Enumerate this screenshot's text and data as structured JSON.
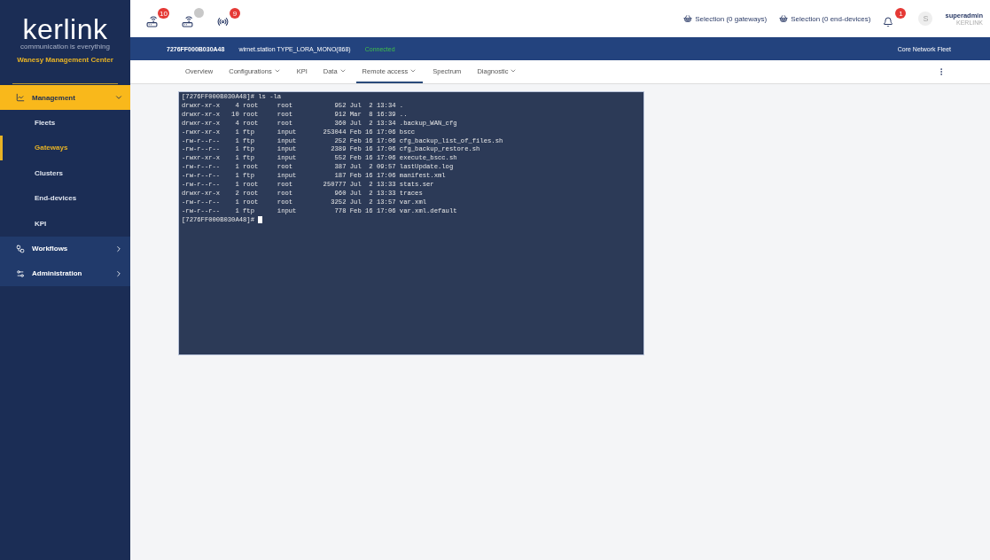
{
  "brand": {
    "logo": "kerlink",
    "tagline": "communication is everything",
    "product": "Wanesy Management Center"
  },
  "header_icons": [
    {
      "kind": "gateway",
      "badge": "10"
    },
    {
      "kind": "gateway-offline"
    },
    {
      "kind": "antenna",
      "badge": "9"
    }
  ],
  "selections": [
    "Selection (0 gateways)",
    "Selection (0 end-devices)"
  ],
  "notifications": {
    "badge": "1"
  },
  "user": {
    "initial": "S",
    "name": "superadmin",
    "org": "KERLINK"
  },
  "device_bar": {
    "id": "7276FF000B030A48",
    "type": "wirnet.station TYPE_LORA_MONO(868)",
    "status": "Connected",
    "fleet": "Core Network Fleet"
  },
  "tabs": [
    {
      "label": "Overview",
      "dropdown": false,
      "selected": false
    },
    {
      "label": "Configurations",
      "dropdown": true,
      "selected": false
    },
    {
      "label": "KPI",
      "dropdown": false,
      "selected": false
    },
    {
      "label": "Data",
      "dropdown": true,
      "selected": false
    },
    {
      "label": "Remote access",
      "dropdown": true,
      "selected": true
    },
    {
      "label": "Spectrum",
      "dropdown": false,
      "selected": false
    },
    {
      "label": "Diagnostic",
      "dropdown": true,
      "selected": false
    }
  ],
  "sidebar": [
    {
      "label": "Management",
      "expanded": true,
      "children": [
        {
          "label": "Fleets",
          "selected": false
        },
        {
          "label": "Gateways",
          "selected": true
        },
        {
          "label": "Clusters",
          "selected": false
        },
        {
          "label": "End-devices",
          "selected": false
        },
        {
          "label": "KPI",
          "selected": false
        }
      ]
    },
    {
      "label": "Workflows",
      "expanded": false
    },
    {
      "label": "Administration",
      "expanded": false
    }
  ],
  "terminal": {
    "lines": [
      "[7276FF000B030A48]# ls -la",
      "drwxr-xr-x    4 root     root           952 Jul  2 13:34 .",
      "drwxr-xr-x   10 root     root           912 Mar  8 16:39 ..",
      "drwxr-xr-x    4 root     root           360 Jul  2 13:34 .backup_WAN_cfg",
      "-rwxr-xr-x    1 ftp      input       253044 Feb 16 17:06 bscc",
      "-rw-r--r--    1 ftp      input          252 Feb 16 17:06 cfg_backup_list_of_files.sh",
      "-rw-r--r--    1 ftp      input         2389 Feb 16 17:06 cfg_backup_restore.sh",
      "-rwxr-xr-x    1 ftp      input          552 Feb 16 17:06 execute_bscc.sh",
      "-rw-r--r--    1 root     root           387 Jul  2 09:57 lastUpdate.log",
      "-rw-r--r--    1 ftp      input          187 Feb 16 17:06 manifest.xml",
      "-rw-r--r--    1 root     root        250777 Jul  2 13:33 stats.ser",
      "drwxr-xr-x    2 root     root           960 Jul  2 13:33 traces",
      "-rw-r--r--    1 root     root          3252 Jul  2 13:57 var.xml",
      "-rw-r--r--    1 ftp      input          778 Feb 16 17:06 var.xml.default"
    ],
    "prompt": "[7276FF000B030A48]#"
  }
}
